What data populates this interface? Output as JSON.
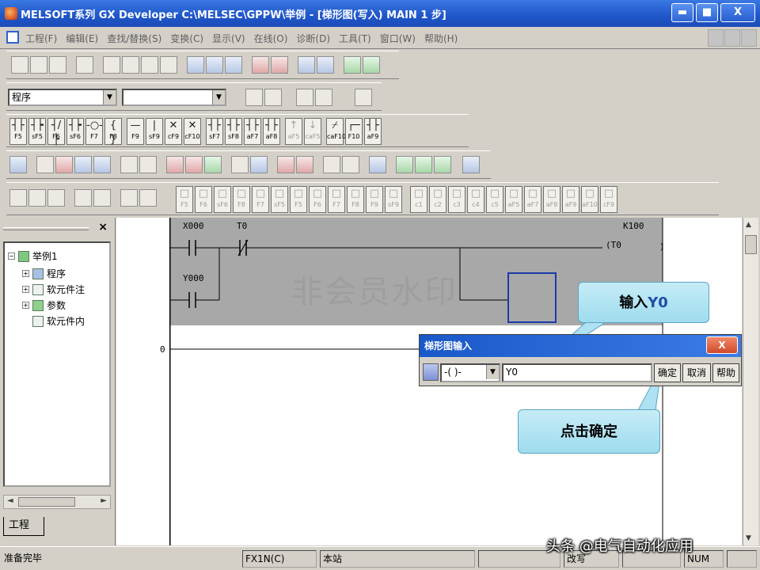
{
  "window": {
    "title": "MELSOFT系列 GX Developer C:\\MELSEC\\GPPW\\举例 - [梯形图(写入)   MAIN   1 步]",
    "min": "▬",
    "max": "■",
    "close": "X"
  },
  "menu": {
    "items": [
      "工程(F)",
      "编辑(E)",
      "查找/替换(S)",
      "变换(C)",
      "显示(V)",
      "在线(O)",
      "诊断(D)",
      "工具(T)",
      "窗口(W)",
      "帮助(H)"
    ]
  },
  "toolbar2": {
    "combo_left": "程序",
    "combo_right": ""
  },
  "fkeys": [
    {
      "sym": "┤├",
      "key": "F5"
    },
    {
      "sym": "┤┝",
      "key": "sF5"
    },
    {
      "sym": "┤/├",
      "key": "F6"
    },
    {
      "sym": "┤┝",
      "key": "sF6"
    },
    {
      "sym": "-○-",
      "key": "F7"
    },
    {
      "sym": "{ }",
      "key": "F8"
    },
    {
      "sym": "—",
      "key": "F9"
    },
    {
      "sym": "|",
      "key": "sF9"
    },
    {
      "sym": "✕",
      "key": "cF9"
    },
    {
      "sym": "✕",
      "key": "cF10"
    },
    {
      "sym": "┤├",
      "key": "sF7"
    },
    {
      "sym": "┤├",
      "key": "sF8"
    },
    {
      "sym": "┤├",
      "key": "aF7"
    },
    {
      "sym": "┤├",
      "key": "aF8"
    },
    {
      "sym": "↑",
      "key": "aF5",
      "dis": true
    },
    {
      "sym": "↓",
      "key": "caF5",
      "dis": true
    },
    {
      "sym": "⌿",
      "key": "caF10"
    },
    {
      "sym": "┌─",
      "key": "F10"
    },
    {
      "sym": "┤├",
      "key": "aF9"
    }
  ],
  "fkeys2": [
    "F5",
    "F6",
    "sF6",
    "F8",
    "F7",
    "sF5",
    "F5",
    "F6",
    "F7",
    "F8",
    "F9",
    "sF9",
    "c1",
    "c2",
    "c3",
    "c4",
    "c5",
    "aF5",
    "aF7",
    "aF8",
    "aF9",
    "aF10",
    "cF9"
  ],
  "tree": {
    "root": "举例1",
    "children": [
      "程序",
      "软元件注",
      "参数",
      "软元件内"
    ]
  },
  "panel_tab": "工程",
  "ladder": {
    "contacts": [
      "X000",
      "T0",
      "Y000"
    ],
    "coil_label": "K100",
    "coil_name": "(T0",
    "coil_end": ")",
    "step0": "0",
    "watermark": "非会员水印"
  },
  "callouts": {
    "input_prefix": "输入",
    "input_value": "Y0",
    "click_ok": "点击确定"
  },
  "dialog": {
    "title": "梯形图输入",
    "close": "X",
    "type_value": "-( )-",
    "input_value": "Y0",
    "ok": "确定",
    "cancel": "取消",
    "help": "帮助"
  },
  "status": {
    "ready": "准备完毕",
    "plc": "FX1N(C)",
    "station": "本站",
    "mode": "改写",
    "num": "NUM"
  },
  "signature": "头条 @电气自动化应用"
}
